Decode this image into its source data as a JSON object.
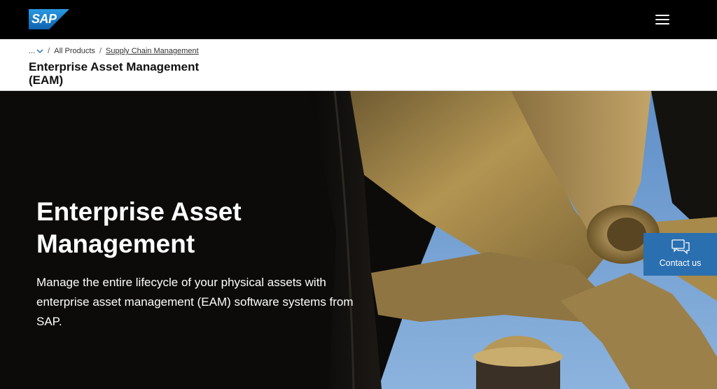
{
  "header": {
    "logo_text": "SAP",
    "menu_icon": "hamburger-menu-icon"
  },
  "breadcrumb": {
    "more_label": "...",
    "more_icon": "chevron-down-icon",
    "separator": "/",
    "items": [
      "All Products",
      "Supply Chain Management"
    ]
  },
  "page_title": "Enterprise Asset Management (EAM)",
  "hero": {
    "title": "Enterprise Asset Management",
    "description": "Manage the entire lifecycle of your physical assets with enterprise asset management (EAM) software systems from SAP."
  },
  "contact": {
    "label": "Contact us",
    "icon": "chat-bubbles-icon"
  },
  "colors": {
    "logo_blue": "#1a7cc9",
    "contact_blue": "#2a6fb0",
    "sky": "#6f9fd2",
    "bronze": "#a88a4a"
  }
}
